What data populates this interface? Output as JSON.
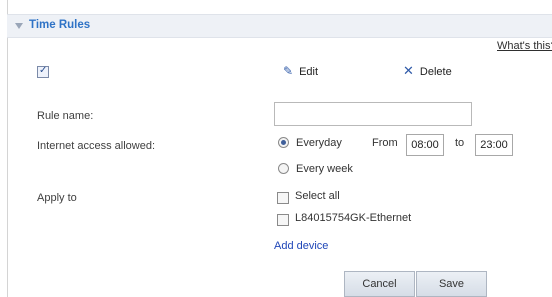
{
  "section": {
    "title": "Time Rules"
  },
  "help_link": "What's this?",
  "toolbar": {
    "edit_label": "Edit",
    "delete_label": "Delete",
    "edit_icon": "pencil-icon",
    "delete_icon": "x-icon",
    "select_row_checked": true
  },
  "form": {
    "rule_name_label": "Rule name:",
    "rule_name_value": "",
    "internet_access_label": "Internet access allowed:",
    "schedule_options": [
      {
        "label": "Everyday",
        "selected": true
      },
      {
        "label": "Every week",
        "selected": false
      }
    ],
    "from_label": "From",
    "from_time": "08:00",
    "to_label": "to",
    "to_time": "23:00",
    "apply_to_label": "Apply to",
    "select_all_label": "Select all",
    "devices": [
      {
        "label": "L84015754GK-Ethernet",
        "checked": false
      }
    ],
    "add_device_label": "Add device"
  },
  "buttons": {
    "cancel": "Cancel",
    "save": "Save"
  },
  "colors": {
    "accent": "#2f73c6",
    "link": "#1f46b8",
    "header_bg": "#eef1f6"
  }
}
